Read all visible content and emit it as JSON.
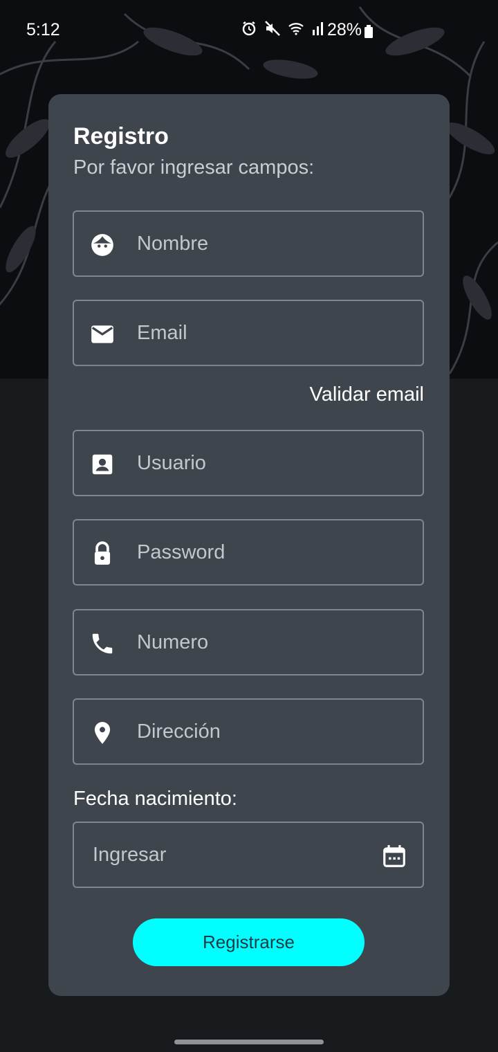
{
  "status_bar": {
    "time": "5:12",
    "battery": "28%",
    "icons": [
      "alarm-icon",
      "mute-icon",
      "wifi-icon",
      "signal-icon",
      "battery-icon"
    ]
  },
  "form": {
    "title": "Registro",
    "subtitle": "Por favor ingresar campos:",
    "fields": [
      {
        "name": "name-field",
        "icon": "face-icon",
        "placeholder": "Nombre"
      },
      {
        "name": "email-field",
        "icon": "mail-icon",
        "placeholder": "Email"
      },
      {
        "name": "username-field",
        "icon": "account-box-icon",
        "placeholder": "Usuario"
      },
      {
        "name": "password-field",
        "icon": "lock-icon",
        "placeholder": "Password"
      },
      {
        "name": "phone-field",
        "icon": "phone-icon",
        "placeholder": "Numero"
      },
      {
        "name": "address-field",
        "icon": "location-pin-icon",
        "placeholder": "Dirección"
      }
    ],
    "validate_email_link": "Validar email",
    "birthdate_label": "Fecha nacimiento:",
    "birthdate_placeholder": "Ingresar",
    "submit_label": "Registrarse"
  },
  "colors": {
    "card": "#3f454c",
    "accent": "#00ffff",
    "background": "#181b1e"
  }
}
